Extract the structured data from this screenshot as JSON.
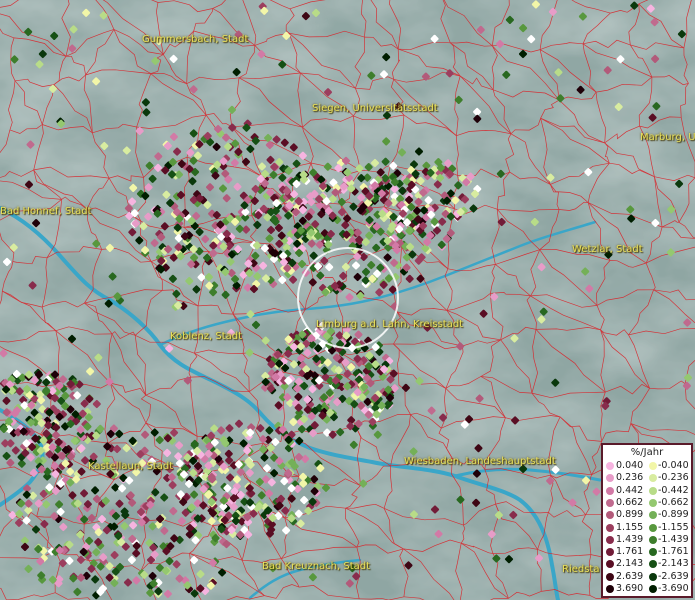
{
  "map": {
    "cities": [
      {
        "id": "gummersbach",
        "name": "Gummersbach, Stadt"
      },
      {
        "id": "siegen",
        "name": "Siegen, Universitätsstadt"
      },
      {
        "id": "marburg",
        "name": "Marburg, Un"
      },
      {
        "id": "badhonnef",
        "name": "Bad Honnef, Stadt"
      },
      {
        "id": "wetzlar",
        "name": "Wetzlar, Stadt"
      },
      {
        "id": "limburg",
        "name": "Limburg a.d. Lahn, Kreisstadt"
      },
      {
        "id": "koblenz",
        "name": "Koblenz, Stadt"
      },
      {
        "id": "wiesbaden",
        "name": "Wiesbaden, Landeshauptstadt"
      },
      {
        "id": "kastellaun",
        "name": "Kastellaun, Stadt"
      },
      {
        "id": "badkreuznach",
        "name": "Bad Kreuznach, Stadt"
      },
      {
        "id": "riedstadt",
        "name": "Riedsta"
      }
    ],
    "selection_ring": {
      "label": "selected-location-ring"
    }
  },
  "legend": {
    "title": "%/Jahr",
    "positive": [
      {
        "label": "0.040",
        "color": "#f6b4e0"
      },
      {
        "label": "0.236",
        "color": "#e79cc8"
      },
      {
        "label": "0.442",
        "color": "#d27aa6"
      },
      {
        "label": "0.662",
        "color": "#c06a8e"
      },
      {
        "label": "0.899",
        "color": "#b25a7a"
      },
      {
        "label": "1.155",
        "color": "#9c3e5e"
      },
      {
        "label": "1.439",
        "color": "#882c4c"
      },
      {
        "label": "1.761",
        "color": "#721c38"
      },
      {
        "label": "2.143",
        "color": "#5a0e24"
      },
      {
        "label": "2.639",
        "color": "#3e0614"
      },
      {
        "label": "3.690",
        "color": "#1e0008"
      }
    ],
    "negative": [
      {
        "label": "-0.040",
        "color": "#f2f6a8"
      },
      {
        "label": "-0.236",
        "color": "#d8eca0"
      },
      {
        "label": "-0.442",
        "color": "#b8dc88"
      },
      {
        "label": "-0.662",
        "color": "#94c870"
      },
      {
        "label": "-0.899",
        "color": "#74b058"
      },
      {
        "label": "-1.155",
        "color": "#58983e"
      },
      {
        "label": "-1.439",
        "color": "#3e7e2c"
      },
      {
        "label": "-1.761",
        "color": "#286820"
      },
      {
        "label": "-2.143",
        "color": "#165014"
      },
      {
        "label": "-2.639",
        "color": "#0a380c"
      },
      {
        "label": "-3.690",
        "color": "#001e00"
      }
    ]
  }
}
